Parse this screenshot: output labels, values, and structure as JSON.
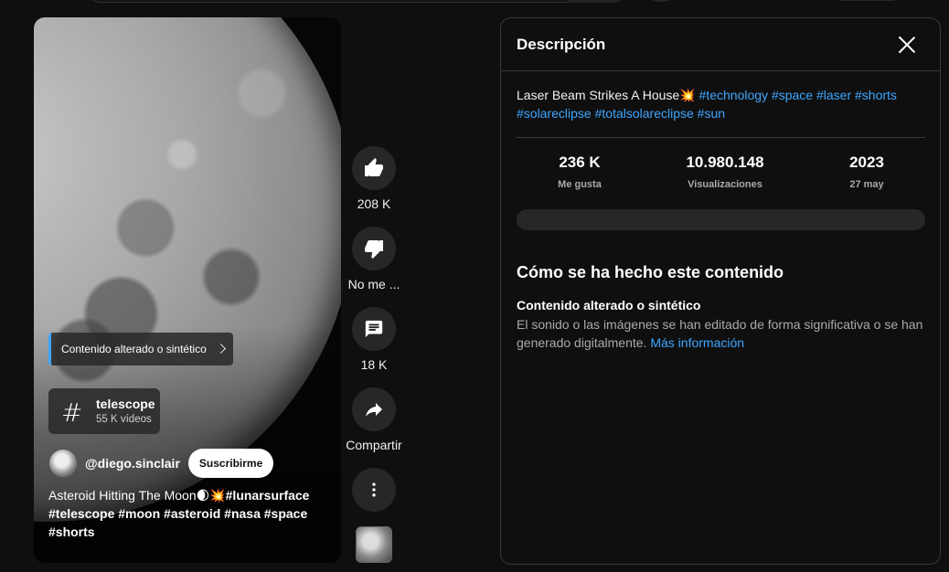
{
  "player": {
    "ai_chip_label": "Contenido alterado o sintético",
    "hashtag": {
      "symbol": "#",
      "name": "telescope",
      "count": "55 K vídeos"
    },
    "channel": {
      "handle": "@diego.sinclair",
      "subscribe_label": "Suscribirme"
    },
    "caption": {
      "line1_text": "Asteroid Hitting The Moon",
      "line1_emoji": "🌒💥",
      "line1_tag": "#lunarsurface",
      "line2": "#telescope #moon  #asteroid #nasa #space",
      "line3": "#shorts"
    }
  },
  "actions": {
    "like_count": "208 K",
    "dislike_label": "No me ...",
    "comment_count": "18 K",
    "share_label": "Compartir"
  },
  "panel": {
    "title": "Descripción",
    "description": {
      "text": "Laser Beam Strikes A House",
      "emoji": "💥",
      "tags": [
        "#technology",
        "#space",
        "#laser",
        "#shorts",
        "#solareclipse",
        "#totalsolareclipse",
        "#sun"
      ]
    },
    "stats": [
      {
        "value": "236 K",
        "label": "Me gusta"
      },
      {
        "value": "10.980.148",
        "label": "Visualizaciones"
      },
      {
        "value": "2023",
        "label": "27 may"
      }
    ],
    "how_made": {
      "title": "Cómo se ha hecho este contenido",
      "subtitle": "Contenido alterado o sintético",
      "text": "El sonido o las imágenes se han editado de forma significativa o se han generado digitalmente.",
      "link": "Más información"
    }
  },
  "colors": {
    "accent_link": "#3ea6ff",
    "background": "#0f0f0f",
    "chip_bg": "#272727"
  },
  "icons": [
    "like-icon",
    "dislike-icon",
    "comment-icon",
    "share-icon",
    "more-vert-icon",
    "close-icon",
    "hashtag-icon",
    "chevron-right-icon"
  ]
}
